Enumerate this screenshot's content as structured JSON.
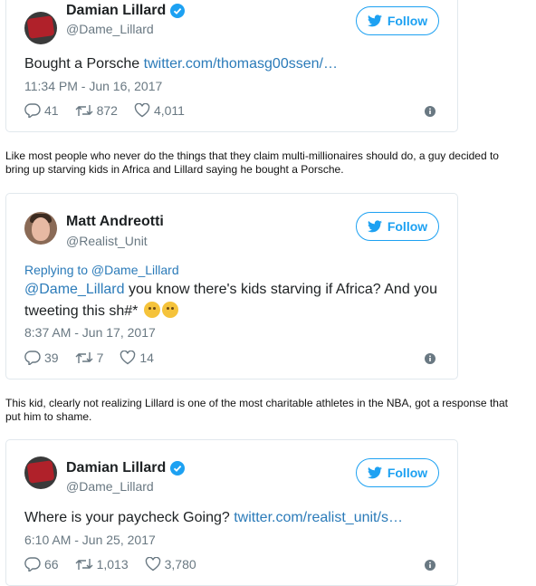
{
  "tweets": [
    {
      "name": "Damian Lillard",
      "handle": "@Dame_Lillard",
      "follow_label": "Follow",
      "text": "Bought a Porsche ",
      "link": "twitter.com/thomasg00ssen/…",
      "timestamp": "11:34 PM - Jun 16, 2017",
      "replies": "41",
      "retweets": "872",
      "likes": "4,011"
    },
    {
      "name": "Matt Andreotti",
      "handle": "@Realist_Unit",
      "follow_label": "Follow",
      "reply_to": "Replying to @Dame_Lillard",
      "mention": "@Dame_Lillard",
      "text": " you know there's kids starving if Africa? And you tweeting this sh#*",
      "timestamp": "8:37 AM - Jun 17, 2017",
      "replies": "39",
      "retweets": "7",
      "likes": "14"
    },
    {
      "name": "Damian Lillard",
      "handle": "@Dame_Lillard",
      "follow_label": "Follow",
      "text": "Where is your paycheck Going? ",
      "link": "twitter.com/realist_unit/s…",
      "timestamp": "6:10 AM - Jun 25, 2017",
      "replies": "66",
      "retweets": "1,013",
      "likes": "3,780"
    }
  ],
  "paragraphs": [
    "Like most people who never do the things that they claim multi-millionaires should do, a guy decided to\nbring up starving kids in Africa and Lillard saying he bought a Porsche.",
    "This kid, clearly not realizing Lillard is one of the most charitable athletes in the NBA, got a response that\nput him to shame."
  ],
  "colors": {
    "accent": "#1da1f2",
    "link": "#2b7bb9",
    "muted": "#697882",
    "border": "#e1e8ed"
  }
}
